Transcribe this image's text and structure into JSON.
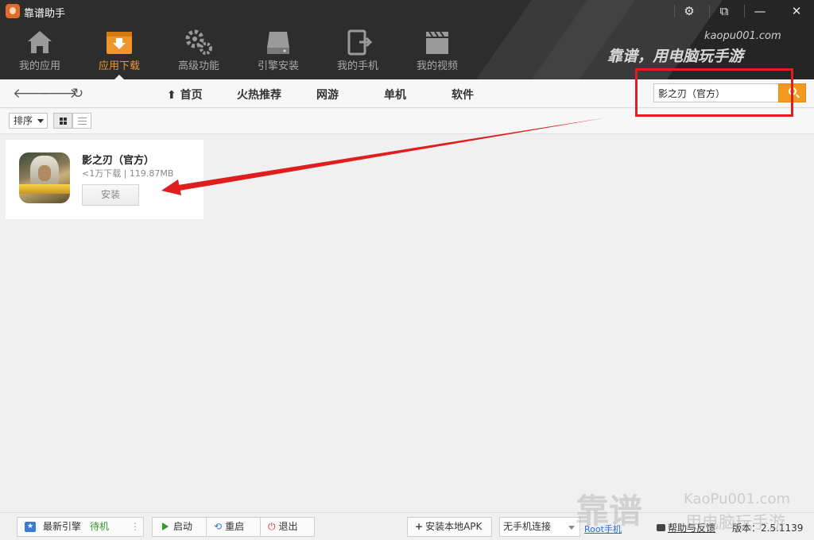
{
  "window": {
    "title": "靠谱助手",
    "buttons": [
      "settings",
      "restore",
      "minimize",
      "close"
    ]
  },
  "nav": {
    "items": [
      {
        "label": "我的应用",
        "icon": "home-icon"
      },
      {
        "label": "应用下载",
        "icon": "download-box-icon",
        "active": true
      },
      {
        "label": "高级功能",
        "icon": "gears-icon"
      },
      {
        "label": "引擎安装",
        "icon": "drive-icon"
      },
      {
        "label": "我的手机",
        "icon": "phone-export-icon"
      },
      {
        "label": "我的视频",
        "icon": "clapper-icon"
      }
    ],
    "accent": "#f0952a"
  },
  "brand": {
    "site": "kaopu001.com",
    "slogan": "靠谱，用电脑玩手游"
  },
  "toolbar": {
    "back_icon": "arrow-left-icon",
    "forward_icon": "arrow-right-icon",
    "refresh_icon": "refresh-icon",
    "categories": [
      "首页",
      "火热推荐",
      "网游",
      "单机",
      "软件"
    ],
    "search": {
      "value": "影之刃（官方）",
      "icon": "search-icon",
      "button_color": "#f39a1e"
    }
  },
  "sortbar": {
    "sort_label": "排序",
    "view_modes": [
      "grid",
      "list"
    ],
    "active_view": "grid"
  },
  "results": [
    {
      "name": "影之刃（官方）",
      "downloads": "<1万下载",
      "size": "119.87MB",
      "install_label": "安装"
    }
  ],
  "annotation": {
    "color": "#e01e1e"
  },
  "statusbar": {
    "engine_label": "最新引擎",
    "engine_status": "待机",
    "start_label": "启动",
    "restart_label": "重启",
    "exit_label": "退出",
    "install_apk_label": "安装本地APK",
    "phone_status": "无手机连接",
    "root_label": "Root手机",
    "help_label": "帮助与反馈",
    "version": "版本：2.5.1139"
  },
  "watermark": {
    "big": "靠谱",
    "site": "KaoPu001.com",
    "slogan": "用电脑玩手游"
  }
}
